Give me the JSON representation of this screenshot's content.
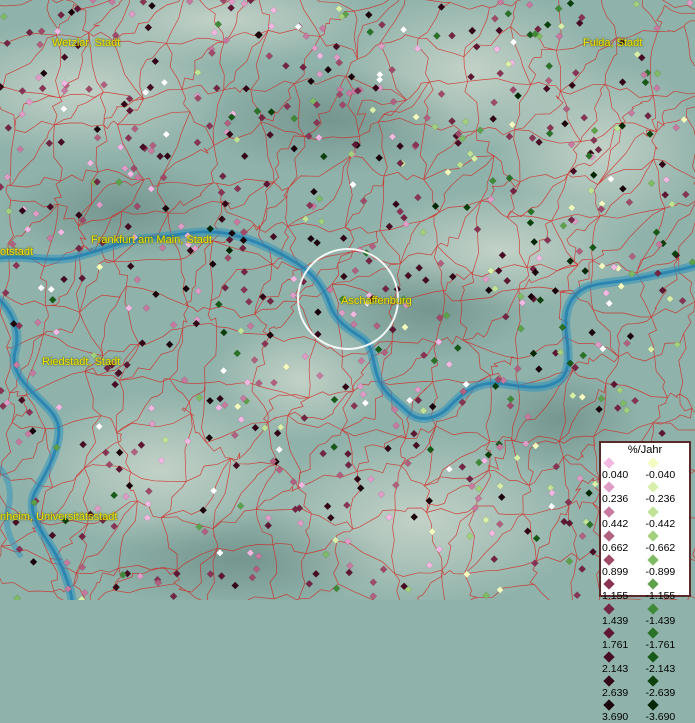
{
  "cities": [
    {
      "id": "wetzlar",
      "label": "Wetzlar, Stadt"
    },
    {
      "id": "fulda",
      "label": "Fulda, Stadt"
    },
    {
      "id": "frankfurt",
      "label": "Frankfurt am Main, Stadt"
    },
    {
      "id": "offenbach",
      "label": "otstadt"
    },
    {
      "id": "aschaffenburg",
      "label": "Aschaffenburg"
    },
    {
      "id": "riedstadt",
      "label": "Riedstadt, Stadt"
    },
    {
      "id": "mannheim",
      "label": "nheim, Universitätsstadt"
    }
  ],
  "legend": {
    "title": "%/Jahr",
    "positive": [
      {
        "label": "0.040",
        "color": "#f2b8e2"
      },
      {
        "label": "0.236",
        "color": "#df9cc6"
      },
      {
        "label": "0.442",
        "color": "#c77a9f"
      },
      {
        "label": "0.662",
        "color": "#b2607f"
      },
      {
        "label": "0.899",
        "color": "#9e4a68"
      },
      {
        "label": "1.155",
        "color": "#893454"
      },
      {
        "label": "1.439",
        "color": "#732543"
      },
      {
        "label": "1.761",
        "color": "#5e1633"
      },
      {
        "label": "2.143",
        "color": "#480b24"
      },
      {
        "label": "2.639",
        "color": "#320416"
      },
      {
        "label": "3.690",
        "color": "#1a0008"
      }
    ],
    "negative": [
      {
        "label": "-0.040",
        "color": "#f4fcc0"
      },
      {
        "label": "-0.236",
        "color": "#d8efaa"
      },
      {
        "label": "-0.442",
        "color": "#bfe295"
      },
      {
        "label": "-0.662",
        "color": "#a2d07d"
      },
      {
        "label": "-0.899",
        "color": "#7fbb64"
      },
      {
        "label": "-1.155",
        "color": "#5ea14b"
      },
      {
        "label": "-1.439",
        "color": "#3f8a36"
      },
      {
        "label": "-1.761",
        "color": "#2a7226"
      },
      {
        "label": "-2.143",
        "color": "#175a17"
      },
      {
        "label": "-2.639",
        "color": "#0b400b"
      },
      {
        "label": "-3.690",
        "color": "#032603"
      }
    ]
  },
  "colors": {
    "terrain": "#8fb2aa",
    "border": "#d4201c",
    "river": "#2f93bd",
    "highlight_circle": "#ffffff",
    "city_label": "#f2e600"
  },
  "icons": {
    "measurement-point": "diamond",
    "selection": "circle"
  }
}
